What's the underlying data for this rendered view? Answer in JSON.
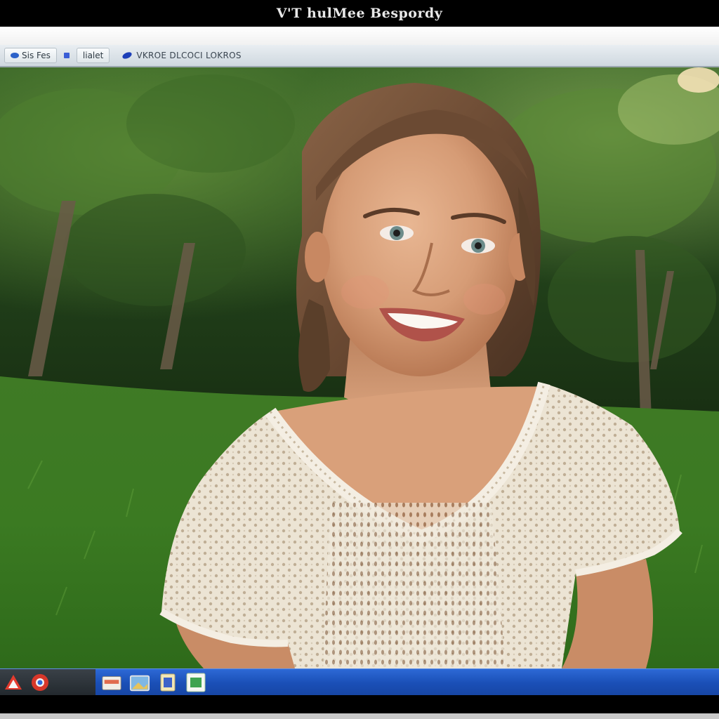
{
  "window": {
    "title": "V'T hulMee Bespordy"
  },
  "toolbar": {
    "button1_label": "Sis Fes",
    "button2_label": "lialet",
    "address_text": "VKROE DLCOCI LOKROS"
  },
  "photo": {
    "description_tag": "portrait-photo"
  },
  "taskbar": {
    "items": [
      "start",
      "app-red",
      "app-chrome",
      "app-folder",
      "app-image",
      "app-word",
      "app-excel"
    ]
  },
  "colors": {
    "taskbar": "#1a4fb6",
    "titlebar": "#000000",
    "toolbar": "#d9e1e7"
  }
}
